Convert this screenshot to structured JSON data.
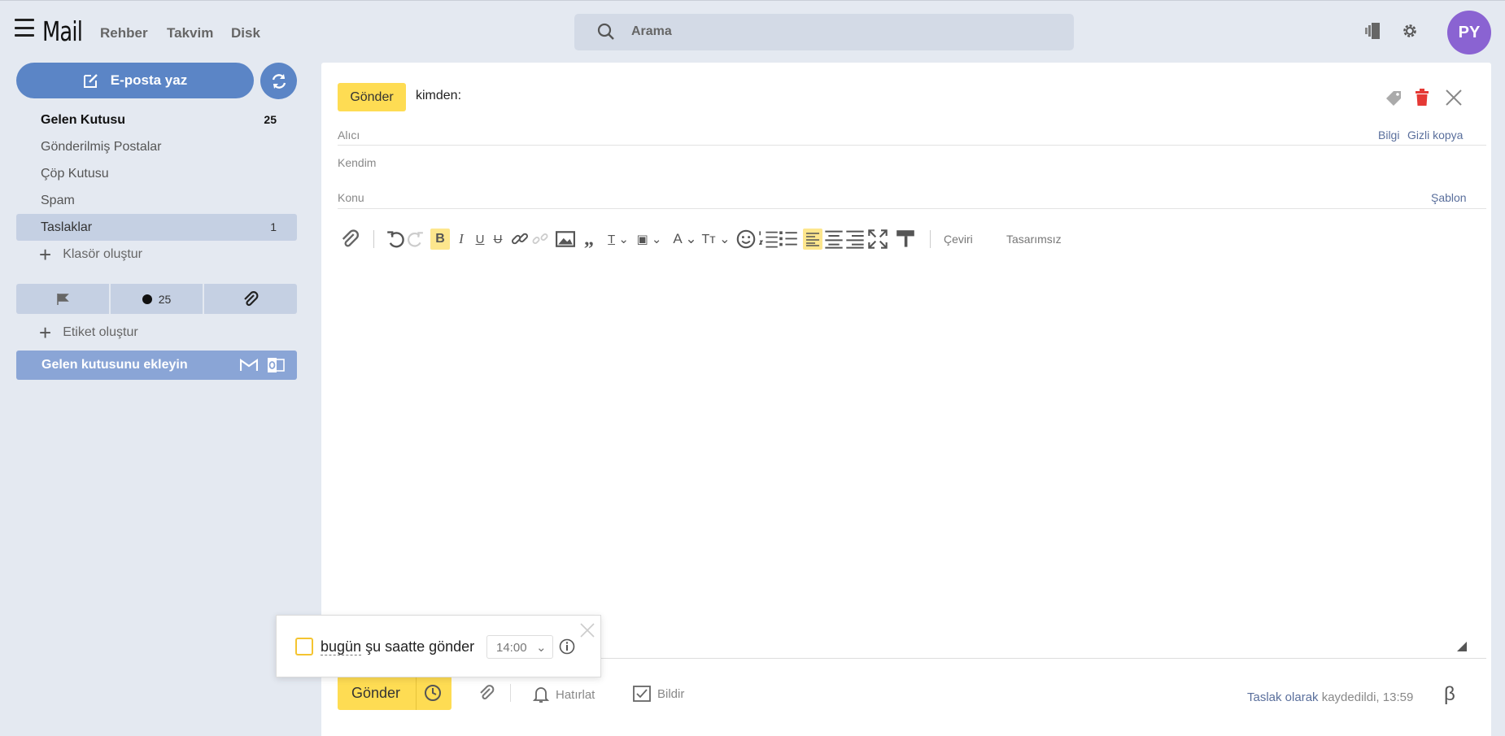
{
  "header": {
    "logo": "Mail",
    "nav": [
      "Rehber",
      "Takvim",
      "Disk"
    ],
    "search_placeholder": "Arama",
    "avatar_initials": "PY"
  },
  "sidebar": {
    "compose_label": "E-posta yaz",
    "folders": [
      {
        "name": "Gelen Kutusu",
        "count": "25"
      },
      {
        "name": "Gönderilmiş Postalar",
        "count": ""
      },
      {
        "name": "Çöp Kutusu",
        "count": ""
      },
      {
        "name": "Spam",
        "count": ""
      },
      {
        "name": "Taslaklar",
        "count": "1"
      }
    ],
    "create_folder": "Klasör oluştur",
    "unread_count": "25",
    "create_label": "Etiket oluştur",
    "add_mailbox": "Gelen kutusunu ekleyin"
  },
  "compose": {
    "send_chip": "Gönder",
    "from_label": "kimden:",
    "to_label": "Alıcı",
    "cc_link": "Bilgi",
    "bcc_link": "Gizli kopya",
    "from_value": "Kendim",
    "subject_label": "Konu",
    "template_link": "Şablon",
    "translate": "Çeviri",
    "no_design": "Tasarımsız",
    "send_button": "Gönder",
    "remind": "Hatırlat",
    "notify": "Bildir",
    "status_link": "Taslak olarak",
    "status_text": " kaydedildi, 13:59",
    "beta": "β"
  },
  "popup": {
    "today_word": "bugün",
    "rest_text": " şu saatte gönder",
    "time_value": "14:00"
  },
  "colors": {
    "accent_blue": "#5b85c6",
    "send_yellow": "#fedc53",
    "avatar_purple": "#8a63d2",
    "trash_red": "#e53935"
  }
}
